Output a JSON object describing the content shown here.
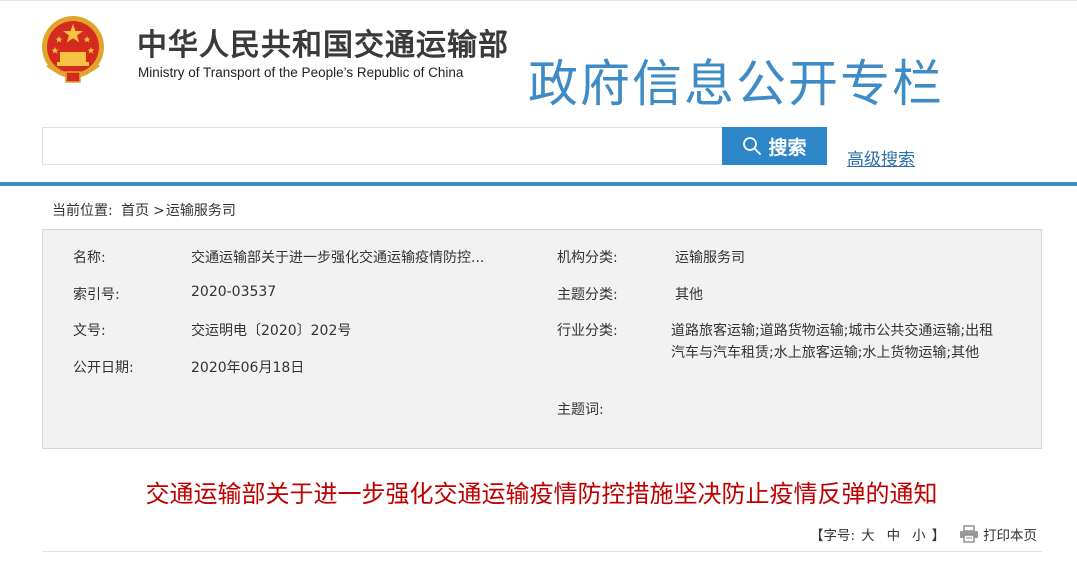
{
  "header": {
    "org_name_cn": "中华人民共和国交通运输部",
    "org_name_en": "Ministry of Transport of the People’s Republic of China",
    "banner": "政府信息公开专栏",
    "banner_color": "#3e8bc5"
  },
  "search": {
    "value": "",
    "placeholder": "",
    "button_label": "搜索",
    "button_icon": "search-icon",
    "advanced_link": "高级搜索"
  },
  "breadcrumb": {
    "prefix": "当前位置:",
    "home": "首页",
    "separator": ">",
    "current": "运输服务司"
  },
  "info": {
    "name_label": "名称:",
    "name_value": "交通运输部关于进一步强化交通运输疫情防控...",
    "index_label": "索引号:",
    "index_value": "2020-03537",
    "doc_no_label": "文号:",
    "doc_no_value": "交运明电〔2020〕202号",
    "date_label": "公开日期:",
    "date_value": "2020年06月18日",
    "org_cat_label": "机构分类:",
    "org_cat_value": "运输服务司",
    "topic_cat_label": "主题分类:",
    "topic_cat_value": "其他",
    "industry_label": "行业分类:",
    "industry_value": "道路旅客运输;道路货物运输;城市公共交通运输;出租汽车与汽车租赁;水上旅客运输;水上货物运输;其他",
    "keywords_label": "主题词:",
    "keywords_value": ""
  },
  "article": {
    "title": "交通运输部关于进一步强化交通运输疫情防控措施坚决防止疫情反弹的通知",
    "title_color": "#c00000"
  },
  "tools": {
    "font_prefix": "【字号:",
    "size_large": "大",
    "size_medium": "中",
    "size_small": "小",
    "font_suffix": "】",
    "print_icon": "printer-icon",
    "print_label": "打印本页"
  }
}
